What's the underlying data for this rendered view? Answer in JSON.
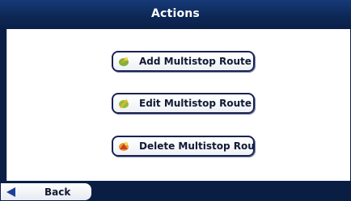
{
  "header": {
    "title": "Actions"
  },
  "actions": [
    {
      "label": "Add Multistop Route",
      "icon": "add-route-icon"
    },
    {
      "label": "Edit Multistop Route",
      "icon": "edit-route-icon"
    },
    {
      "label": "Delete Multistop Route",
      "icon": "delete-route-icon"
    }
  ],
  "footer": {
    "back_label": "Back",
    "back_icon": "left-arrow-icon"
  },
  "colors": {
    "title_bar": "#0d2856",
    "content_bg": "#ffffff",
    "button_border": "#1a2350",
    "back_arrow": "#1e3f9a"
  }
}
